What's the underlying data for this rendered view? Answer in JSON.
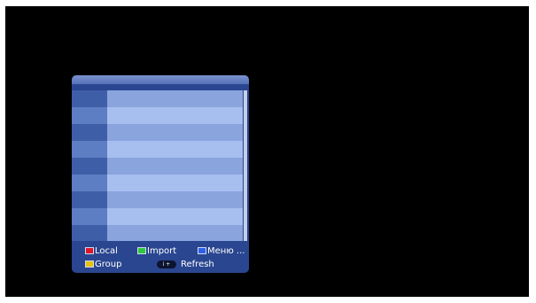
{
  "colors": {
    "screen_bg": "#000000",
    "panel_bg": "#2a4690",
    "header": "#6a84c6",
    "row_odd_number": "#3f5ea8",
    "row_odd_name": "#8aa4de",
    "row_even_number": "#5e7ec3",
    "row_even_name": "#a6bfef",
    "key_red": "#e0142a",
    "key_green": "#2ec83a",
    "key_blue": "#2e62e6",
    "key_yellow": "#e8c20e"
  },
  "list": {
    "rows": [
      {
        "number": "",
        "name": ""
      },
      {
        "number": "",
        "name": ""
      },
      {
        "number": "",
        "name": ""
      },
      {
        "number": "",
        "name": ""
      },
      {
        "number": "",
        "name": ""
      },
      {
        "number": "",
        "name": ""
      },
      {
        "number": "",
        "name": ""
      },
      {
        "number": "",
        "name": ""
      },
      {
        "number": "",
        "name": ""
      }
    ]
  },
  "footer": {
    "local_label": "Local",
    "import_label": "Import",
    "menu_label": "Меню ...",
    "group_label": "Group",
    "info_key_label": "i +",
    "refresh_label": "Refresh"
  },
  "icons": {
    "red_key": "red-key-icon",
    "green_key": "green-key-icon",
    "blue_key": "blue-key-icon",
    "yellow_key": "yellow-key-icon",
    "info_key": "info-key-icon"
  }
}
